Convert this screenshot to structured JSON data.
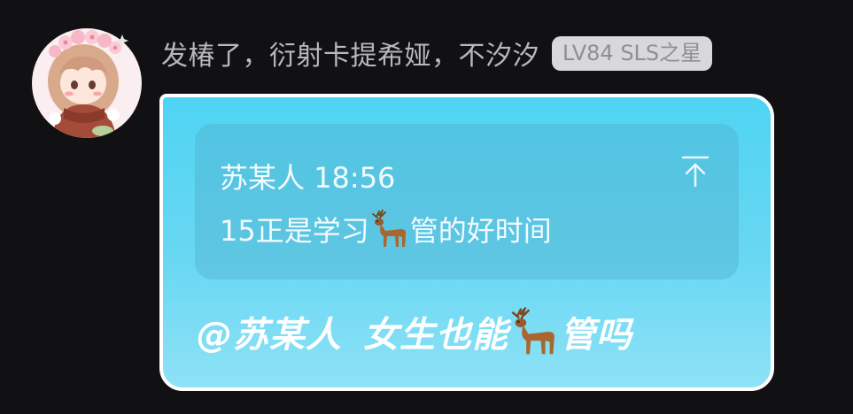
{
  "message": {
    "sender_name": "发椿了，衍射卡提希娅，不汐汐",
    "level_badge": "LV84 SLS之星",
    "quote": {
      "author": "苏某人",
      "time": "18:56",
      "text_before_emoji": "15正是学习",
      "emoji": "deer",
      "text_after_emoji": "管的好时间"
    },
    "reply": {
      "mention": "@苏某人",
      "text_before_emoji": "女生也能",
      "emoji": "deer",
      "text_after_emoji": "管吗"
    }
  },
  "icons": {
    "jump_to_quote": "arrow-up-to-line-icon",
    "deer": "deer-emoji-icon",
    "avatar": "anime-girl-avatar"
  },
  "colors": {
    "background": "#111113",
    "bubble_top": "#4fd4f3",
    "bubble_bottom": "#8ee2f6",
    "bubble_border": "#ffffff",
    "badge_bg": "#d8d8dc",
    "badge_text": "#8e8e94",
    "sender_text": "#b8b8bd"
  }
}
